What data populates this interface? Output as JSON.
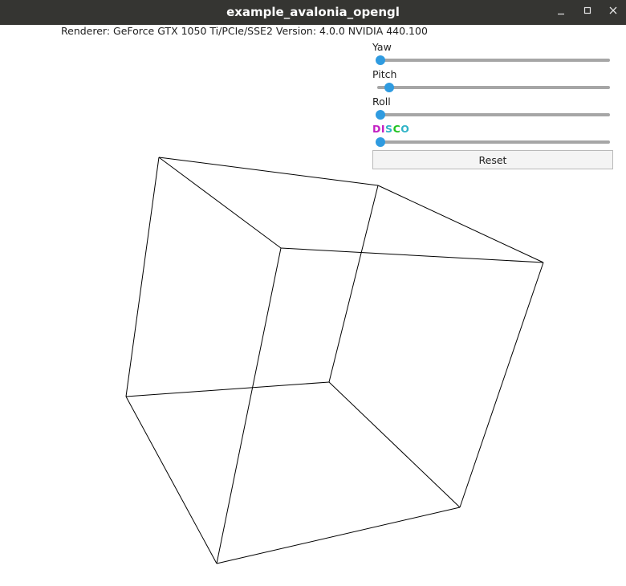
{
  "window": {
    "title": "example_avalonia_opengl"
  },
  "info": {
    "renderer_text": "Renderer: GeForce GTX 1050 Ti/PCIe/SSE2 Version: 4.0.0 NVIDIA 440.100"
  },
  "controls": {
    "yaw": {
      "label": "Yaw",
      "value": 0.0
    },
    "pitch": {
      "label": "Pitch",
      "value": 0.04
    },
    "roll": {
      "label": "Roll",
      "value": 0.0
    },
    "disco": {
      "letters": [
        "D",
        "I",
        "S",
        "C",
        "O"
      ],
      "letter_colors": [
        "#c21fc2",
        "#c21fc2",
        "#2fb3c7",
        "#1ec21e",
        "#2fb3c7"
      ],
      "value": 0.0
    },
    "reset_label": "Reset"
  },
  "colors": {
    "titlebar": "#353532",
    "slider_thumb": "#2f9be0",
    "slider_track": "#a6a6a6",
    "cube_lines": "#000000"
  }
}
